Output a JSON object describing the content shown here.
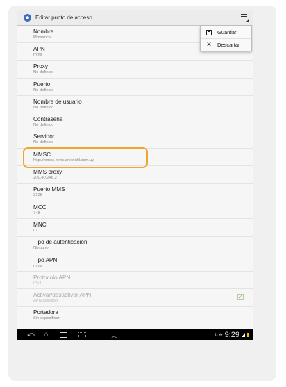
{
  "header": {
    "title": "Editar punto de acceso",
    "overflow_icon": "overflow-menu-icon",
    "app_icon": "apn-settings-icon"
  },
  "menu": {
    "items": [
      {
        "label": "Guardar",
        "icon": "save-icon"
      },
      {
        "label": "Descartar",
        "icon": "close-icon"
      }
    ]
  },
  "settings": [
    {
      "title": "Nombre",
      "value": "Mmsancel"
    },
    {
      "title": "APN",
      "value": "mms"
    },
    {
      "title": "Proxy",
      "value": "No definido"
    },
    {
      "title": "Puerto",
      "value": "No definido"
    },
    {
      "title": "Nombre de usuario",
      "value": "No definido"
    },
    {
      "title": "Contraseña",
      "value": "No definido"
    },
    {
      "title": "Servidor",
      "value": "No definido"
    },
    {
      "title": "MMSC",
      "value": "http://mmsc.mms.ancelutil.com.uy"
    },
    {
      "title": "MMS proxy",
      "value": "200.40.246.2"
    },
    {
      "title": "Puerto MMS",
      "value": "3128"
    },
    {
      "title": "MCC",
      "value": "748"
    },
    {
      "title": "MNC",
      "value": "01"
    },
    {
      "title": "Tipo de autenticación",
      "value": "Ninguno"
    },
    {
      "title": "Tipo APN",
      "value": "mms"
    },
    {
      "title": "Protocolo APN",
      "value": "IPv4"
    },
    {
      "title": "Activar/desactivar APN",
      "value": "APN activado",
      "checked": true
    },
    {
      "title": "Portadora",
      "value": "Sin especificar"
    }
  ],
  "navbar": {
    "time": "9:29"
  },
  "colors": {
    "highlight": "#f0a52b",
    "accent": "#3d6fbd"
  }
}
